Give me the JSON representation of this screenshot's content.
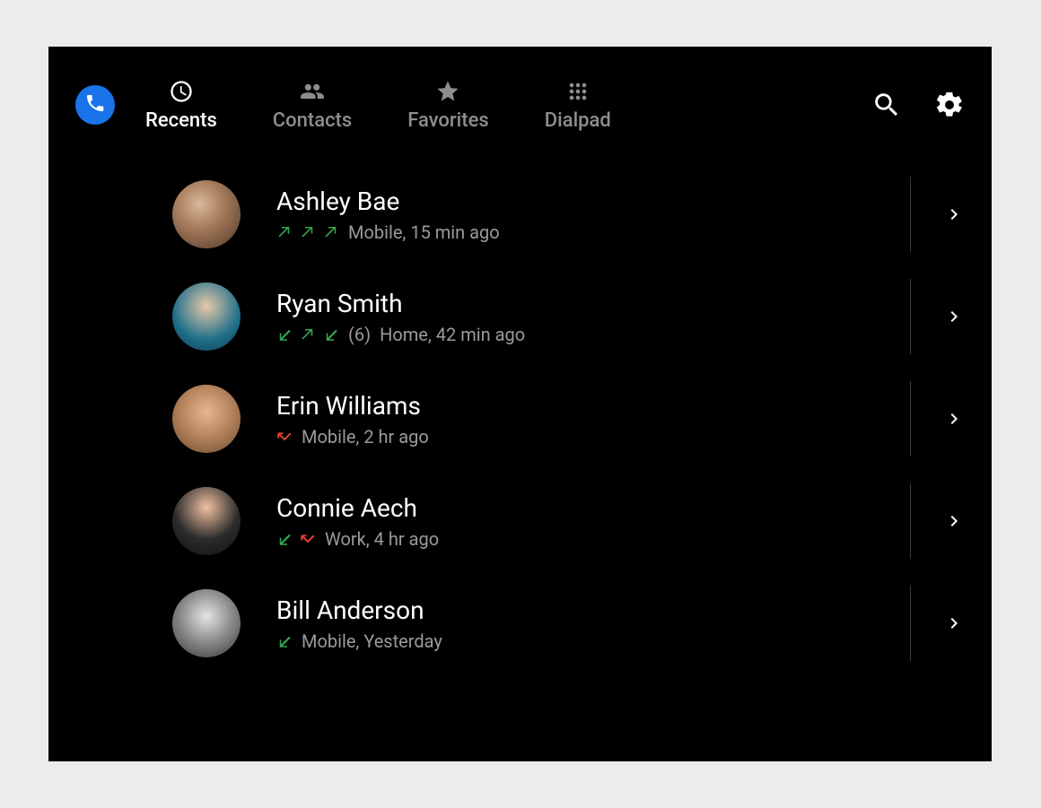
{
  "tabs": [
    {
      "label": "Recents",
      "icon": "clock",
      "active": true
    },
    {
      "label": "Contacts",
      "icon": "people",
      "active": false
    },
    {
      "label": "Favorites",
      "icon": "star",
      "active": false
    },
    {
      "label": "Dialpad",
      "icon": "dialpad",
      "active": false
    }
  ],
  "calls": [
    {
      "name": "Ashley Bae",
      "avatar_class": "ava1",
      "direction_icons": [
        "out-green",
        "out-green",
        "out-green"
      ],
      "count_text": "",
      "meta": "Mobile, 15 min ago"
    },
    {
      "name": "Ryan Smith",
      "avatar_class": "ava2",
      "direction_icons": [
        "in-green",
        "out-green",
        "in-green"
      ],
      "count_text": "(6)",
      "meta": "Home, 42 min ago"
    },
    {
      "name": "Erin Williams",
      "avatar_class": "ava3",
      "direction_icons": [
        "missed-red"
      ],
      "count_text": "",
      "meta": "Mobile, 2 hr ago"
    },
    {
      "name": "Connie Aech",
      "avatar_class": "ava4",
      "direction_icons": [
        "in-green",
        "missed-red"
      ],
      "count_text": "",
      "meta": "Work, 4 hr ago"
    },
    {
      "name": "Bill Anderson",
      "avatar_class": "ava5",
      "direction_icons": [
        "in-green"
      ],
      "count_text": "",
      "meta": "Mobile, Yesterday"
    }
  ],
  "icons": {
    "app": "phone-icon",
    "search": "search-icon",
    "settings": "gear-icon"
  }
}
